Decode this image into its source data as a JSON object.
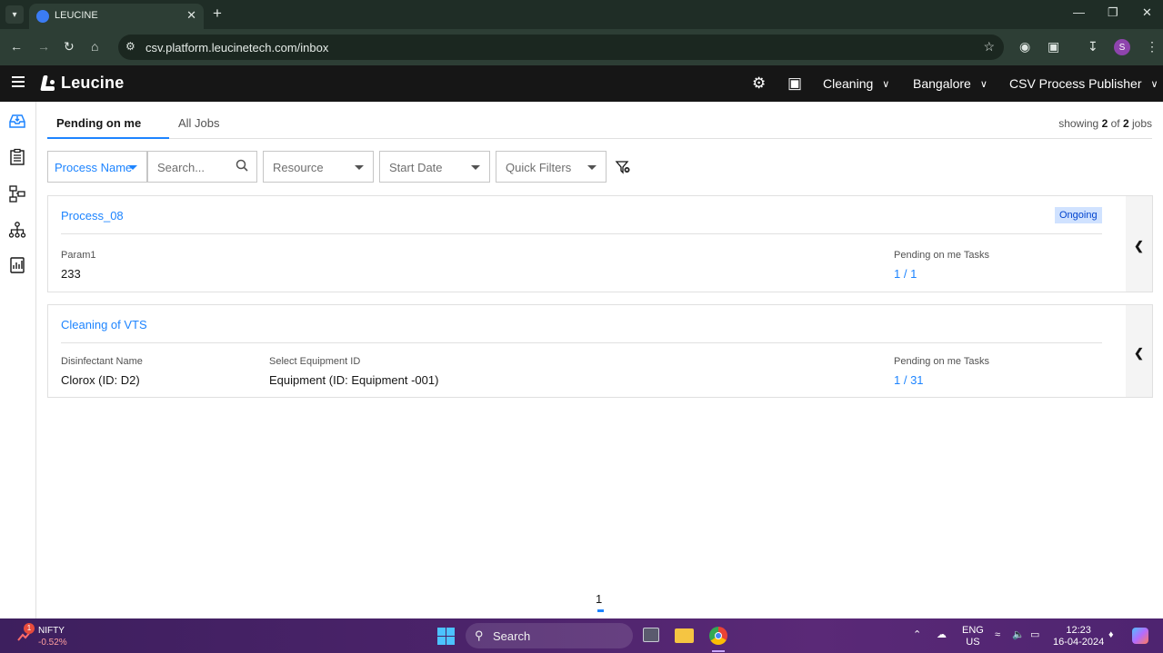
{
  "browser": {
    "tab_title": "LEUCINE",
    "url": "csv.platform.leucinetech.com/inbox",
    "profile_initial": "S"
  },
  "app": {
    "brand": "Leucine",
    "facility_dropdown": "Cleaning",
    "location_dropdown": "Bangalore",
    "role_dropdown": "CSV Process Publisher"
  },
  "tabs": {
    "pending": "Pending on me",
    "all": "All Jobs"
  },
  "showing": {
    "prefix": "showing",
    "count": "2",
    "of": "of",
    "total": "2",
    "suffix": "jobs"
  },
  "filters": {
    "process_name": "Process Name",
    "search_placeholder": "Search...",
    "resource": "Resource",
    "start_date": "Start Date",
    "quick_filters": "Quick Filters"
  },
  "jobs": [
    {
      "title": "Process_08",
      "status": "Ongoing",
      "params": [
        {
          "label": "Param1",
          "value": "233"
        }
      ],
      "tasks_label": "Pending on me Tasks",
      "tasks_value": "1 / 1"
    },
    {
      "title": "Cleaning of VTS",
      "status": "",
      "params": [
        {
          "label": "Disinfectant Name",
          "value": "Clorox (ID: D2)"
        },
        {
          "label": "Select Equipment ID",
          "value": "Equipment (ID: Equipment -001)"
        }
      ],
      "tasks_label": "Pending on me Tasks",
      "tasks_value": "1 / 31"
    }
  ],
  "pagination": {
    "current": "1"
  },
  "taskbar": {
    "stock_name": "NIFTY",
    "stock_change": "-0.52%",
    "notification_count": "1",
    "search_label": "Search",
    "lang_top": "ENG",
    "lang_bottom": "US",
    "time": "12:23",
    "date": "16-04-2024"
  },
  "colors": {
    "accent": "#1d84ff",
    "appbar": "#161616",
    "badge_bg": "#d0e2ff",
    "badge_text": "#0043ce"
  }
}
